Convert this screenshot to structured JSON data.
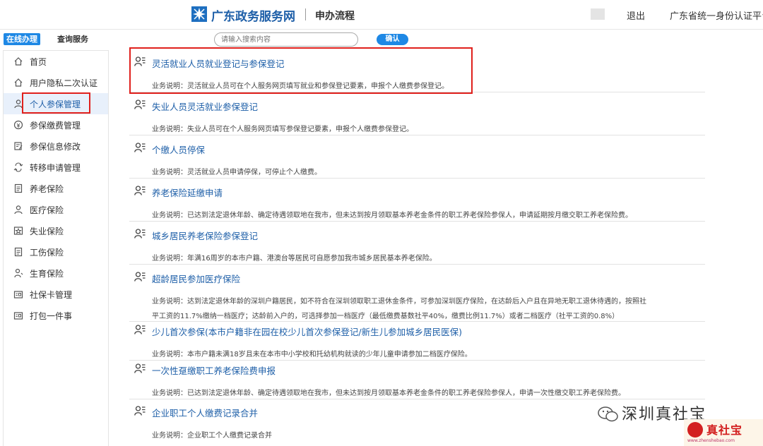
{
  "header": {
    "site_name": "广东政务服务网",
    "section": "申办流程",
    "logout": "退出",
    "auth_platform": "广东省统一身份认证平台"
  },
  "subbar": {
    "tab_online": "在线办理",
    "tab_query": "查询服务",
    "search_placeholder": "请输入搜索内容",
    "search_button": "确认"
  },
  "sidebar": {
    "items": [
      {
        "label": "首页",
        "icon": "home-icon"
      },
      {
        "label": "用户隐私二次认证",
        "icon": "home-icon"
      },
      {
        "label": "个人参保管理",
        "icon": "person-icon",
        "active": true
      },
      {
        "label": "参保缴费管理",
        "icon": "coin-icon"
      },
      {
        "label": "参保信息修改",
        "icon": "edit-icon"
      },
      {
        "label": "转移申请管理",
        "icon": "transfer-icon"
      },
      {
        "label": "养老保险",
        "icon": "document-icon"
      },
      {
        "label": "医疗保险",
        "icon": "person-icon"
      },
      {
        "label": "失业保险",
        "icon": "badge-icon"
      },
      {
        "label": "工伤保险",
        "icon": "document-icon"
      },
      {
        "label": "生育保险",
        "icon": "baby-icon"
      },
      {
        "label": "社保卡管理",
        "icon": "card-icon"
      },
      {
        "label": "打包一件事",
        "icon": "card-icon"
      }
    ]
  },
  "services": {
    "desc_prefix": "业务说明：",
    "items": [
      {
        "title": "灵活就业人员就业登记与参保登记",
        "desc": [
          "灵活就业人员可在个人服务网页填写就业和参保登记要素，申报个人缴费参保登记。"
        ]
      },
      {
        "title": "失业人员灵活就业参保登记",
        "desc": [
          "失业人员可在个人服务网页填写参保登记要素，申报个人缴费参保登记。"
        ]
      },
      {
        "title": "个缴人员停保",
        "desc": [
          "灵活就业人员申请停保，可停止个人缴费。"
        ]
      },
      {
        "title": "养老保险延缴申请",
        "desc": [
          "已达到法定退休年龄、确定待遇领取地在我市，但未达到按月领取基本养老金条件的职工养老保险参保人，申请延期按月缴交职工养老保险费。"
        ]
      },
      {
        "title": "城乡居民养老保险参保登记",
        "desc": [
          "年满16周岁的本市户籍、港澳台等居民可自愿参加我市城乡居民基本养老保险。"
        ]
      },
      {
        "title": "超龄居民参加医疗保险",
        "desc": [
          "达到法定退休年龄的深圳户籍居民，如不符合在深圳领取职工退休金条件，可参加深圳医疗保险，在达龄后入户且在异地无职工退休待遇的，按照社",
          "平工资的11.7%缴纳一档医疗；达龄前入户的，可选择参加一档医疗（最低缴费基数社平40%，缴费比例11.7%）或者二档医疗（社平工资的0.8%）"
        ]
      },
      {
        "title": "少儿首次参保(本市户籍非在园在校少儿首次参保登记/新生儿参加城乡居民医保)",
        "desc": [
          "本市户籍未满18岁且未在本市中小学校和托幼机构就读的少年儿童申请参加二档医疗保险。"
        ]
      },
      {
        "title": "一次性趸缴职工养老保险费申报",
        "desc": [
          "已达到法定退休年龄、确定待遇领取地在我市，但未达到按月领取基本养老金条件的职工养老保险参保人，申请一次性缴交职工养老保险费。"
        ]
      },
      {
        "title": "企业职工个人缴费记录合并",
        "desc": [
          "企业职工个人缴费记录合并"
        ]
      }
    ]
  },
  "watermark": {
    "account": "深圳真社宝",
    "brand": "真社宝",
    "url": "www.zhenshebao.com"
  },
  "colors": {
    "brand_blue": "#1e5fa8",
    "accent_blue": "#1e88e5",
    "highlight_red": "#e0201c"
  }
}
